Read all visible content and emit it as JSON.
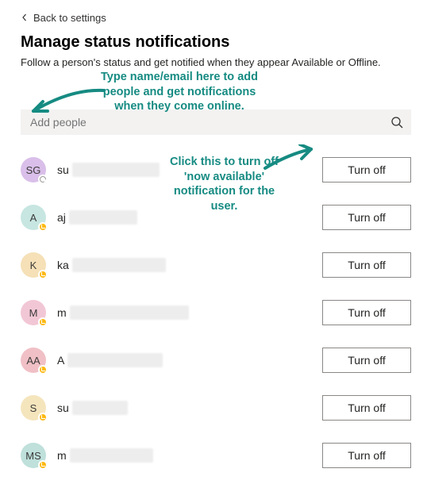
{
  "back_label": "Back to settings",
  "title": "Manage status notifications",
  "description": "Follow a person's status and get notified when they appear Available or Offline.",
  "search_placeholder": "Add people",
  "turn_off_label": "Turn off",
  "annotations": {
    "add_hint": "Type name/email here to add people and get notifications when they come online.",
    "turnoff_hint": "Click this to turn off 'now available' notification for the user."
  },
  "people": [
    {
      "initials": "SG",
      "frag": "su",
      "color": "#d9bfe9",
      "presence": "offline",
      "blur_w": 110
    },
    {
      "initials": "A",
      "frag": "aj",
      "color": "#c7e6e1",
      "presence": "away",
      "blur_w": 86
    },
    {
      "initials": "K",
      "frag": "ka",
      "color": "#f5e0b7",
      "presence": "away",
      "blur_w": 118
    },
    {
      "initials": "M",
      "frag": "m",
      "color": "#f2c7d5",
      "presence": "away",
      "blur_w": 150
    },
    {
      "initials": "AA",
      "frag": "A",
      "color": "#f0c0c6",
      "presence": "away",
      "blur_w": 120
    },
    {
      "initials": "S",
      "frag": "su",
      "color": "#f5e5bd",
      "presence": "away",
      "blur_w": 70
    },
    {
      "initials": "MS",
      "frag": "m",
      "color": "#bfe0db",
      "presence": "away",
      "blur_w": 105
    }
  ]
}
